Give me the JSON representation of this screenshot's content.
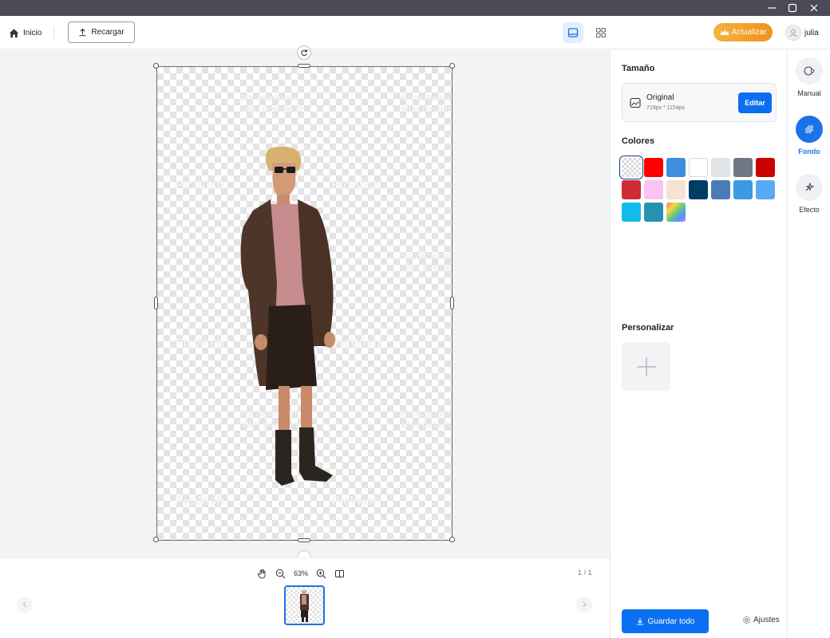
{
  "window": {
    "controls": [
      "minimize-icon",
      "maximize-icon",
      "close-icon"
    ]
  },
  "toolbar": {
    "home_label": "Inicio",
    "reload_label": "Recargar",
    "upgrade_label": "Actualizar",
    "username": "julia"
  },
  "canvas": {
    "watermark_text_1": "No watermark",
    "watermark_text_2": "after download",
    "watermark_logo": "PicWish"
  },
  "bottom": {
    "zoom_level": "63%",
    "page_count": "1 / 1"
  },
  "panel": {
    "size_title": "Tamaño",
    "size_name": "Original",
    "size_dims": "719px * 1154px",
    "edit_label": "Editar",
    "colors_title": "Colores",
    "colors": [
      "transparent",
      "#ff0000",
      "#3e8ee0",
      "#ffffff",
      "#e2e3e6",
      "#6f7787",
      "#cc0000",
      "#cd2b35",
      "#f9c4f2",
      "#f6e2d2",
      "#003d66",
      "#4a7bb7",
      "#3b9ae1",
      "#5aa9f5",
      "#0fbcec",
      "#2592b4",
      "rainbow"
    ],
    "selected_color_index": 0,
    "custom_title": "Personalizar",
    "save_all_label": "Guardar todo",
    "settings_label": "Ajustes"
  },
  "tools": [
    {
      "label": "Manual",
      "icon": "manual-icon",
      "active": false
    },
    {
      "label": "Fondo",
      "icon": "background-icon",
      "active": true
    },
    {
      "label": "Efecto",
      "icon": "effect-icon",
      "active": false
    }
  ],
  "colors": {
    "accent": "#1a73e8",
    "button_blue": "#0a6ff0",
    "upgrade_start": "#f4b43e",
    "upgrade_end": "#f0901e",
    "titlebar": "#4a4b57"
  }
}
